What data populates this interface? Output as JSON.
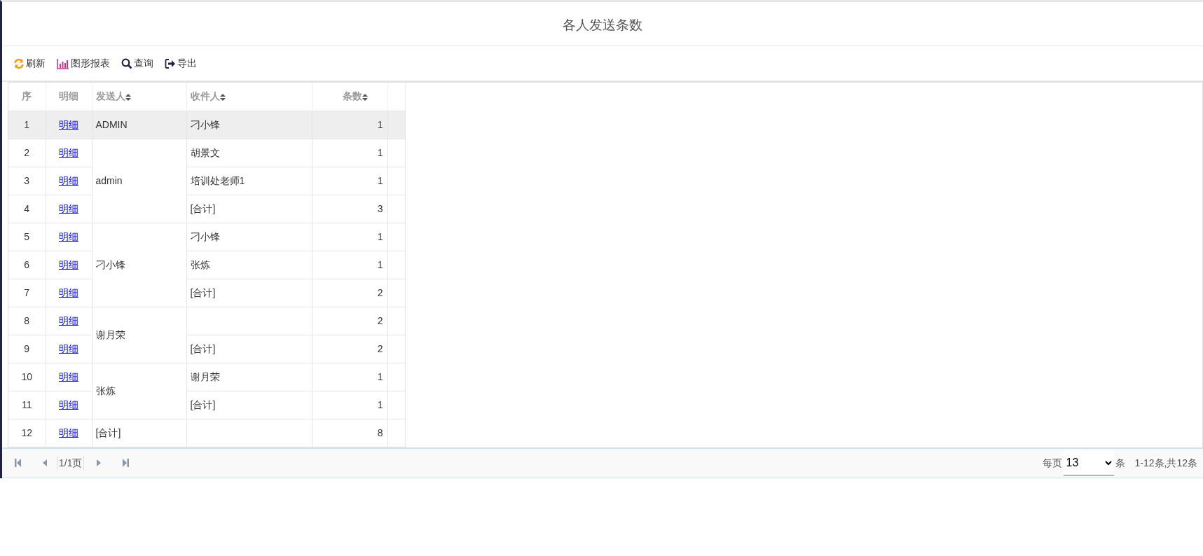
{
  "title": "各人发送条数",
  "toolbar": [
    {
      "kind": "refresh",
      "label": "刷新"
    },
    {
      "kind": "chart",
      "label": "图形报表"
    },
    {
      "kind": "search",
      "label": "查询"
    },
    {
      "kind": "export",
      "label": "导出"
    }
  ],
  "table": {
    "columns": [
      {
        "label": "序",
        "sortable": false
      },
      {
        "label": "明细",
        "sortable": false
      },
      {
        "label": "发送人",
        "sortable": true
      },
      {
        "label": "收件人",
        "sortable": true
      },
      {
        "label": "条数",
        "sortable": true
      }
    ],
    "groups": [
      {
        "sender": "ADMIN",
        "rows": [
          {
            "seq": "1",
            "link": "明细",
            "receiver": "刁小锋",
            "count": "1",
            "selected": true
          }
        ]
      },
      {
        "sender": "admin",
        "rows": [
          {
            "seq": "2",
            "link": "明细",
            "receiver": "胡景文",
            "count": "1",
            "selected": false
          },
          {
            "seq": "3",
            "link": "明细",
            "receiver": "培训处老师1",
            "count": "1",
            "selected": false
          },
          {
            "seq": "4",
            "link": "明细",
            "receiver": "[合计]",
            "count": "3",
            "selected": false
          }
        ]
      },
      {
        "sender": "刁小锋",
        "rows": [
          {
            "seq": "5",
            "link": "明细",
            "receiver": "刁小锋",
            "count": "1",
            "selected": false
          },
          {
            "seq": "6",
            "link": "明细",
            "receiver": "张炼",
            "count": "1",
            "selected": false
          },
          {
            "seq": "7",
            "link": "明细",
            "receiver": "[合计]",
            "count": "2",
            "selected": false
          }
        ]
      },
      {
        "sender": "谢月荣",
        "rows": [
          {
            "seq": "8",
            "link": "明细",
            "count": "2",
            "selected": false
          },
          {
            "seq": "9",
            "link": "明细",
            "receiver": "[合计]",
            "count": "2",
            "selected": false
          }
        ]
      },
      {
        "sender": "张炼",
        "rows": [
          {
            "seq": "10",
            "link": "明细",
            "receiver": "谢月荣",
            "count": "1",
            "selected": false
          },
          {
            "seq": "11",
            "link": "明细",
            "receiver": "[合计]",
            "count": "1",
            "selected": false
          }
        ]
      },
      {
        "sender": "[合计]",
        "rows": [
          {
            "seq": "12",
            "link": "明细",
            "count": "8",
            "selected": false
          }
        ]
      }
    ]
  },
  "pager": {
    "page": "1/1页",
    "per_page_label": "每页",
    "per_page": "13",
    "per_page_unit": "条",
    "summary": "1-12条,共12条"
  }
}
